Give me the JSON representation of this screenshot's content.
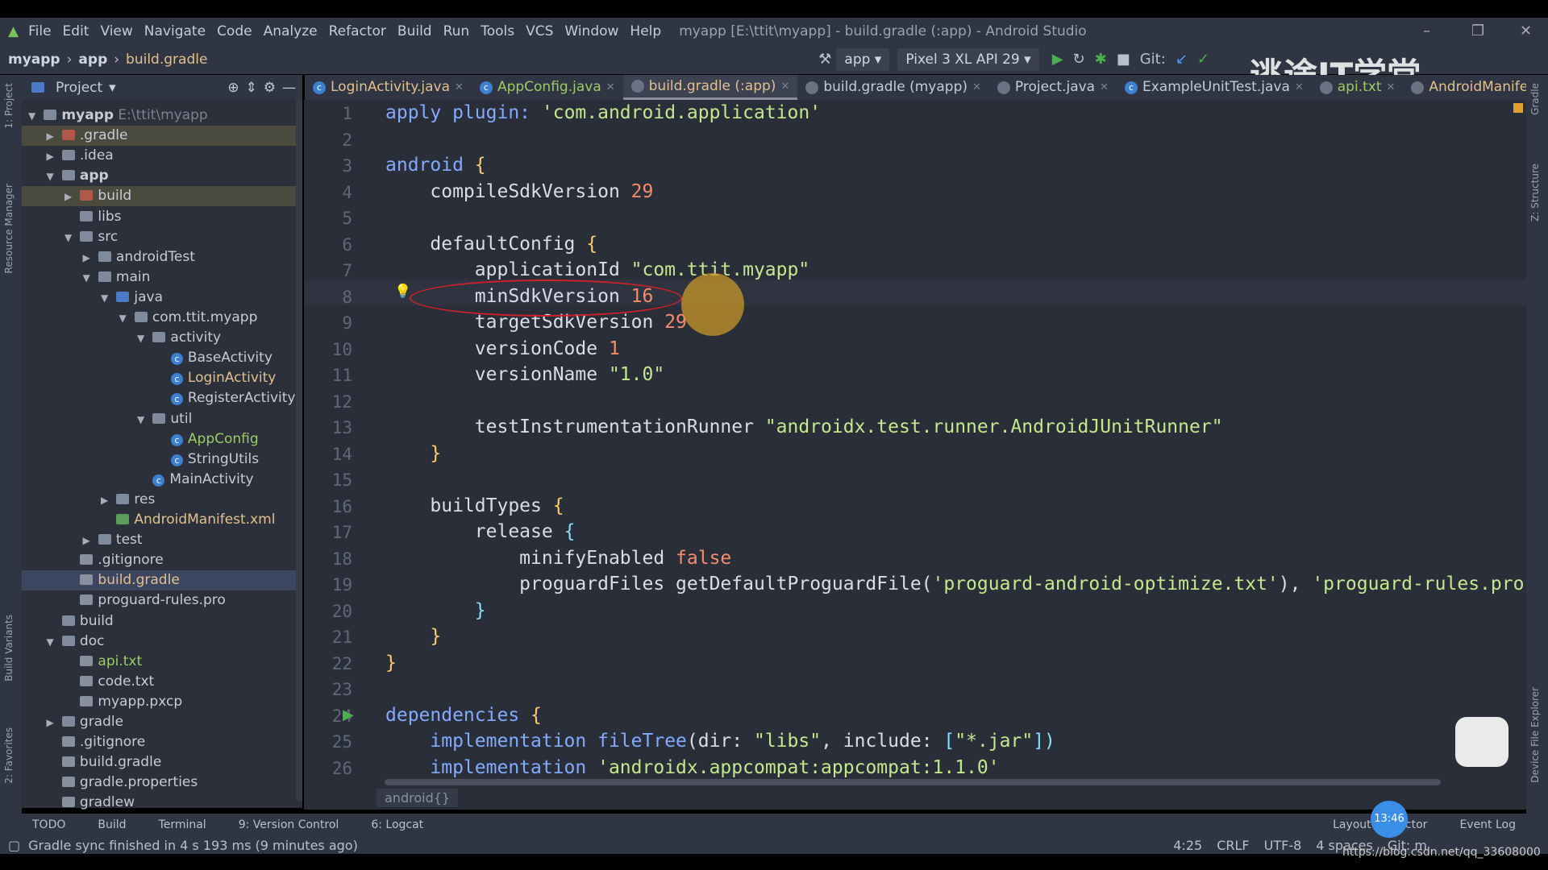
{
  "window": {
    "title": "myapp [E:\\ttit\\myapp] - build.gradle (:app) - Android Studio"
  },
  "menu": [
    "File",
    "Edit",
    "View",
    "Navigate",
    "Code",
    "Analyze",
    "Refactor",
    "Build",
    "Run",
    "Tools",
    "VCS",
    "Window",
    "Help"
  ],
  "nav": {
    "crumbs": [
      "myapp",
      "app",
      "build.gradle"
    ],
    "run_config": "app",
    "device": "Pixel 3 XL API 29",
    "git_label": "Git:"
  },
  "tabs": [
    {
      "label": "LoginActivity.java",
      "icon": "class-icon",
      "color": "#e2c08d",
      "active": false
    },
    {
      "label": "AppConfig.java",
      "icon": "class-icon",
      "color": "#9ccc65",
      "active": false
    },
    {
      "label": "build.gradle (:app)",
      "icon": "gradle-icon",
      "color": "#e2c08d",
      "active": true
    },
    {
      "label": "build.gradle (myapp)",
      "icon": "gradle-icon",
      "color": "#c5ccd6",
      "active": false
    },
    {
      "label": "Project.java",
      "icon": "java-icon",
      "color": "#c5ccd6",
      "active": false
    },
    {
      "label": "ExampleUnitTest.java",
      "icon": "class-icon",
      "color": "#c5ccd6",
      "active": false
    },
    {
      "label": "api.txt",
      "icon": "text-icon",
      "color": "#9ccc65",
      "active": false
    },
    {
      "label": "AndroidManifest.xml",
      "icon": "manifest-icon",
      "color": "#e2c08d",
      "active": false
    }
  ],
  "project_panel": {
    "title": "Project",
    "tree": [
      {
        "name": "myapp",
        "extra": "E:\\ttit\\myapp",
        "depth": 0,
        "arrow": "down",
        "icon": "folder",
        "bold": true
      },
      {
        "name": ".gradle",
        "depth": 1,
        "arrow": "right",
        "icon": "folder-orange",
        "hl": true
      },
      {
        "name": ".idea",
        "depth": 1,
        "arrow": "right",
        "icon": "folder"
      },
      {
        "name": "app",
        "depth": 1,
        "arrow": "down",
        "icon": "folder-module",
        "bold": true
      },
      {
        "name": "build",
        "depth": 2,
        "arrow": "right",
        "icon": "folder-orange",
        "hl": true
      },
      {
        "name": "libs",
        "depth": 2,
        "icon": "folder"
      },
      {
        "name": "src",
        "depth": 2,
        "arrow": "down",
        "icon": "folder"
      },
      {
        "name": "androidTest",
        "depth": 3,
        "arrow": "right",
        "icon": "folder"
      },
      {
        "name": "main",
        "depth": 3,
        "arrow": "down",
        "icon": "folder"
      },
      {
        "name": "java",
        "depth": 4,
        "arrow": "down",
        "icon": "folder-blue"
      },
      {
        "name": "com.ttit.myapp",
        "depth": 5,
        "arrow": "down",
        "icon": "package"
      },
      {
        "name": "activity",
        "depth": 6,
        "arrow": "down",
        "icon": "package"
      },
      {
        "name": "BaseActivity",
        "depth": 7,
        "icon": "class"
      },
      {
        "name": "LoginActivity",
        "depth": 7,
        "icon": "class",
        "color": "#e2c08d"
      },
      {
        "name": "RegisterActivity",
        "depth": 7,
        "icon": "class"
      },
      {
        "name": "util",
        "depth": 6,
        "arrow": "down",
        "icon": "package"
      },
      {
        "name": "AppConfig",
        "depth": 7,
        "icon": "class",
        "color": "#9ccc65"
      },
      {
        "name": "StringUtils",
        "depth": 7,
        "icon": "class"
      },
      {
        "name": "MainActivity",
        "depth": 6,
        "icon": "class"
      },
      {
        "name": "res",
        "depth": 4,
        "arrow": "right",
        "icon": "folder"
      },
      {
        "name": "AndroidManifest.xml",
        "depth": 4,
        "icon": "manifest",
        "color": "#e2c08d"
      },
      {
        "name": "test",
        "depth": 3,
        "arrow": "right",
        "icon": "folder"
      },
      {
        "name": ".gitignore",
        "depth": 2,
        "icon": "file"
      },
      {
        "name": "build.gradle",
        "depth": 2,
        "icon": "gradle",
        "color": "#e2c08d",
        "selected": true
      },
      {
        "name": "proguard-rules.pro",
        "depth": 2,
        "icon": "file"
      },
      {
        "name": "build",
        "depth": 1,
        "icon": "folder"
      },
      {
        "name": "doc",
        "depth": 1,
        "arrow": "down",
        "icon": "folder"
      },
      {
        "name": "api.txt",
        "depth": 2,
        "icon": "file",
        "color": "#9ccc65"
      },
      {
        "name": "code.txt",
        "depth": 2,
        "icon": "file"
      },
      {
        "name": "myapp.pxcp",
        "depth": 2,
        "icon": "file"
      },
      {
        "name": "gradle",
        "depth": 1,
        "arrow": "right",
        "icon": "folder"
      },
      {
        "name": ".gitignore",
        "depth": 1,
        "icon": "file"
      },
      {
        "name": "build.gradle",
        "depth": 1,
        "icon": "gradle"
      },
      {
        "name": "gradle.properties",
        "depth": 1,
        "icon": "gradle"
      },
      {
        "name": "gradlew",
        "depth": 1,
        "icon": "file"
      }
    ]
  },
  "editor": {
    "lines": [
      [
        [
          "apply plugin: ",
          "k"
        ],
        [
          "'com.android.application'",
          "s"
        ]
      ],
      [],
      [
        [
          "android ",
          "k"
        ],
        [
          "{",
          "b"
        ]
      ],
      [
        [
          "    compileSdkVersion ",
          ""
        ],
        [
          "29",
          "n"
        ]
      ],
      [],
      [
        [
          "    defaultConfig ",
          ""
        ],
        [
          "{",
          "b"
        ]
      ],
      [
        [
          "        applicationId ",
          ""
        ],
        [
          "\"com.ttit.myapp\"",
          "s"
        ]
      ],
      [
        [
          "        minSdkVersion ",
          ""
        ],
        [
          "16",
          "n"
        ]
      ],
      [
        [
          "        targetSdkVersion ",
          ""
        ],
        [
          "29",
          "n"
        ]
      ],
      [
        [
          "        versionCode ",
          ""
        ],
        [
          "1",
          "n"
        ]
      ],
      [
        [
          "        versionName ",
          ""
        ],
        [
          "\"1.0\"",
          "s"
        ]
      ],
      [],
      [
        [
          "        testInstrumentationRunner ",
          ""
        ],
        [
          "\"androidx.test.runner.AndroidJUnitRunner\"",
          "s"
        ]
      ],
      [
        [
          "    }",
          "b"
        ]
      ],
      [],
      [
        [
          "    buildTypes ",
          ""
        ],
        [
          "{",
          "b"
        ]
      ],
      [
        [
          "        release ",
          ""
        ],
        [
          "{",
          "p"
        ]
      ],
      [
        [
          "            minifyEnabled ",
          ""
        ],
        [
          "false",
          "fl"
        ]
      ],
      [
        [
          "            proguardFiles getDefaultProguardFile(",
          ""
        ],
        [
          "'proguard-android-optimize.txt'",
          "s"
        ],
        [
          "), ",
          ""
        ],
        [
          "'proguard-rules.pro'",
          "s"
        ]
      ],
      [
        [
          "        }",
          "p"
        ]
      ],
      [
        [
          "    }",
          "b"
        ]
      ],
      [
        [
          "}",
          "b"
        ]
      ],
      [],
      [
        [
          "dependencies ",
          "k"
        ],
        [
          "{",
          "b"
        ]
      ],
      [
        [
          "    implementation ",
          "k"
        ],
        [
          "fileTree",
          "k"
        ],
        [
          "(dir: ",
          ""
        ],
        [
          "\"libs\"",
          "s"
        ],
        [
          ", include: ",
          ""
        ],
        [
          "[",
          "p"
        ],
        [
          "\"*.jar\"",
          "s"
        ],
        [
          "])",
          "p"
        ]
      ],
      [
        [
          "    implementation ",
          "k"
        ],
        [
          "'androidx.appcompat:appcompat:1.1.0'",
          "s"
        ]
      ]
    ],
    "breadcrumb": "android{}",
    "current_line": 4
  },
  "tool_windows": {
    "left": [
      "TODO",
      "Build",
      "Terminal",
      "9: Version Control",
      "6: Logcat"
    ],
    "right": [
      "Layout Inspector",
      "Event Log"
    ]
  },
  "side_tabs": {
    "left": [
      "1: Project",
      "Resource Manager",
      "Build Variants",
      "2: Favorites"
    ],
    "right": [
      "Gradle",
      "Z: Structure",
      "Device File Explorer"
    ]
  },
  "status": {
    "message": "Gradle sync finished in 4 s 193 ms (9 minutes ago)",
    "position": "4:25",
    "line_sep": "CRLF",
    "encoding": "UTF-8",
    "indent": "4 spaces",
    "git": "Git: m"
  },
  "overlay": {
    "watermark": "逃途IT学堂 bilibili",
    "url": "https://blog.csdn.net/qq_33608000",
    "clock": "13:46"
  }
}
